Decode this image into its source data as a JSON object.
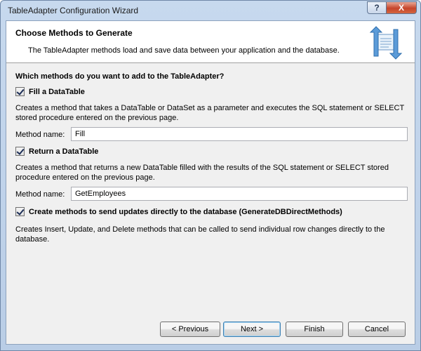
{
  "window": {
    "title": "TableAdapter Configuration Wizard",
    "help_label": "?",
    "close_label": "X"
  },
  "header": {
    "title": "Choose Methods to Generate",
    "description": "The TableAdapter methods load and save data between your application and the database.",
    "icon": "wizard-arrows-icon"
  },
  "main": {
    "question": "Which methods do you want to add to the TableAdapter?",
    "fill": {
      "checked": true,
      "label": "Fill a DataTable",
      "description": "Creates a method that takes a DataTable or DataSet as a parameter and executes the SQL statement or SELECT stored procedure entered on the previous page.",
      "method_label": "Method name:",
      "method_value": "Fill"
    },
    "return": {
      "checked": true,
      "label": "Return a DataTable",
      "description": "Creates a method that returns a new DataTable filled with the results of the SQL statement or SELECT stored procedure entered on the previous page.",
      "method_label": "Method name:",
      "method_value": "GetEmployees"
    },
    "direct": {
      "checked": true,
      "label": "Create methods to send updates directly to the database (GenerateDBDirectMethods)",
      "description": "Creates Insert, Update, and Delete methods that can be called to send individual row changes directly to the database."
    }
  },
  "footer": {
    "previous": "< Previous",
    "next": "Next >",
    "finish": "Finish",
    "cancel": "Cancel"
  }
}
